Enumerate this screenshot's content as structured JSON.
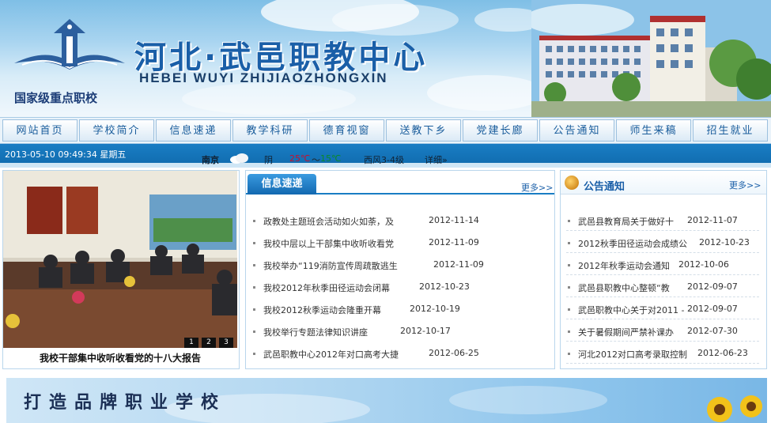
{
  "header": {
    "title": "河北·武邑职教中心",
    "subtitle": "HEBEI WUYI ZHIJIAOZHONGXIN",
    "badge": "国家级重点职校"
  },
  "nav": {
    "items": [
      "网站首页",
      "学校简介",
      "信息速递",
      "教学科研",
      "德育视窗",
      "送教下乡",
      "党建长廊",
      "公告通知",
      "师生来稿",
      "招生就业"
    ]
  },
  "status": {
    "datetime": "2013-05-10 09:49:34 星期五",
    "city": "南京",
    "condition": "阴",
    "temp_low": "25℃",
    "temp_sep": "～",
    "temp_high": "15℃",
    "wind": "西风3-4级",
    "detail_link": "详细»",
    "icon": "cloud-icon"
  },
  "photo": {
    "caption": "我校干部集中收听收看党的十八大报告",
    "pager": [
      "1",
      "2",
      "3"
    ]
  },
  "news": {
    "tab_label": "信息速递",
    "more_label": "更多>>",
    "items": [
      {
        "title": "政教处主题班会活动如火如荼，及",
        "date": "2012-11-14"
      },
      {
        "title": "我校中层以上干部集中收听收看党",
        "date": "2012-11-09"
      },
      {
        "title": "我校举办“119消防宣传周疏散逃生",
        "date": "2012-11-09"
      },
      {
        "title": "我校2012年秋季田径运动会闭幕",
        "date": "2012-10-23"
      },
      {
        "title": "我校2012秋季运动会隆重开幕",
        "date": "2012-10-19"
      },
      {
        "title": "我校举行专题法律知识讲座",
        "date": "2012-10-17"
      },
      {
        "title": "武邑职教中心2012年对口高考大捷",
        "date": "2012-06-25"
      }
    ]
  },
  "notice": {
    "title": "公告通知",
    "more_label": "更多>>",
    "items": [
      {
        "title": "武邑县教育局关于做好十",
        "date": "2012-11-07"
      },
      {
        "title": "2012秋季田径运动会成绩公",
        "date": "2012-10-23"
      },
      {
        "title": "2012年秋季运动会通知",
        "date": "2012-10-06"
      },
      {
        "title": "武邑县职教中心整顿“教",
        "date": "2012-09-07"
      },
      {
        "title": "武邑职教中心关于对2011 -",
        "date": "2012-09-07"
      },
      {
        "title": "关于暑假期间严禁补课办",
        "date": "2012-07-30"
      },
      {
        "title": "河北2012对口高考录取控制",
        "date": "2012-06-23"
      }
    ]
  },
  "bottom": {
    "slogan": "打造品牌职业学校"
  },
  "colors": {
    "accent": "#1a7dc4",
    "nav_text": "#1a5d9c",
    "temp_low": "#c8102e",
    "temp_high": "#0a8a2a"
  }
}
